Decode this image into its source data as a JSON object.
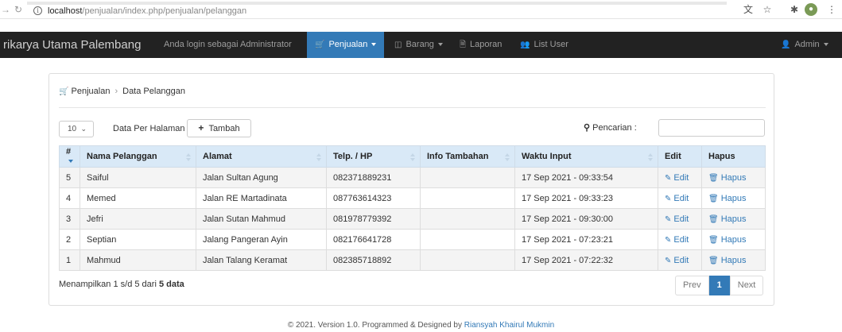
{
  "browser": {
    "url_host": "localhost",
    "url_path": "/penjualan/index.php/penjualan/pelanggan"
  },
  "navbar": {
    "brand": "rikarya Utama Palembang",
    "login_text": "Anda login sebagai Administrator",
    "items": [
      {
        "label": "Penjualan",
        "icon": "cart-icon"
      },
      {
        "label": "Barang",
        "icon": "cube-icon"
      },
      {
        "label": "Laporan",
        "icon": "file-icon"
      },
      {
        "label": "List User",
        "icon": "users-icon"
      }
    ],
    "user": "Admin",
    "active_color": "#337ab7"
  },
  "breadcrumb": {
    "section": "Penjualan",
    "current": "Data Pelanggan"
  },
  "controls": {
    "per_page_value": "10",
    "per_page_label": "Data Per Halaman",
    "add_button": "Tambah",
    "search_label": "Pencarian :",
    "search_value": ""
  },
  "table": {
    "headers": [
      "#",
      "Nama Pelanggan",
      "Alamat",
      "Telp. / HP",
      "Info Tambahan",
      "Waktu Input",
      "Edit",
      "Hapus"
    ],
    "edit_label": "Edit",
    "delete_label": "Hapus",
    "rows": [
      {
        "no": "5",
        "nama": "Saiful",
        "alamat": "Jalan Sultan Agung",
        "telp": "082371889231",
        "info": "",
        "waktu": "17 Sep 2021 - 09:33:54"
      },
      {
        "no": "4",
        "nama": "Memed",
        "alamat": "Jalan RE Martadinata",
        "telp": "087763614323",
        "info": "",
        "waktu": "17 Sep 2021 - 09:33:23"
      },
      {
        "no": "3",
        "nama": "Jefri",
        "alamat": "Jalan Sutan Mahmud",
        "telp": "081978779392",
        "info": "",
        "waktu": "17 Sep 2021 - 09:30:00"
      },
      {
        "no": "2",
        "nama": "Septian",
        "alamat": "Jalang Pangeran Ayin",
        "telp": "082176641728",
        "info": "",
        "waktu": "17 Sep 2021 - 07:23:21"
      },
      {
        "no": "1",
        "nama": "Mahmud",
        "alamat": "Jalan Talang Keramat",
        "telp": "082385718892",
        "info": "",
        "waktu": "17 Sep 2021 - 07:22:32"
      }
    ]
  },
  "summary": {
    "prefix": "Menampilkan 1 s/d 5 dari",
    "total": "5 data"
  },
  "pagination": {
    "prev": "Prev",
    "current": "1",
    "next": "Next"
  },
  "footer": {
    "text": "© 2021. Version 1.0. Programmed & Designed by",
    "author": "Riansyah Khairul Mukmin"
  }
}
